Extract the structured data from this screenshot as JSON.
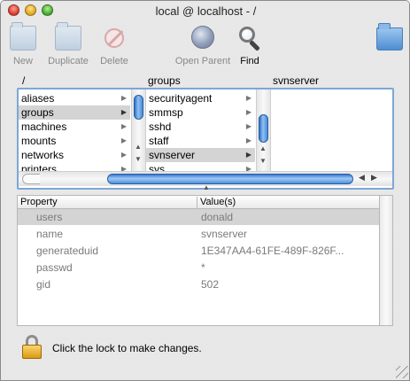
{
  "window": {
    "title": "local @ localhost - /"
  },
  "toolbar": {
    "new_label": "New",
    "duplicate_label": "Duplicate",
    "delete_label": "Delete",
    "open_parent_label": "Open Parent",
    "find_label": "Find"
  },
  "browser": {
    "columns": [
      {
        "header": "/",
        "items": [
          "aliases",
          "groups",
          "machines",
          "mounts",
          "networks",
          "printers"
        ],
        "selected": "groups"
      },
      {
        "header": "groups",
        "items": [
          "securityagent",
          "smmsp",
          "sshd",
          "staff",
          "svnserver",
          "sys"
        ],
        "selected": "svnserver"
      },
      {
        "header": "svnserver",
        "items": []
      }
    ]
  },
  "properties": {
    "header_property": "Property",
    "header_values": "Value(s)",
    "rows": [
      {
        "key": "users",
        "value": "donald",
        "selected": true
      },
      {
        "key": "name",
        "value": "svnserver"
      },
      {
        "key": "generateduid",
        "value": "1E347AA4-61FE-489F-826F..."
      },
      {
        "key": "passwd",
        "value": "*"
      },
      {
        "key": "gid",
        "value": "502"
      }
    ]
  },
  "footer": {
    "lock_text": "Click the lock to make changes."
  }
}
